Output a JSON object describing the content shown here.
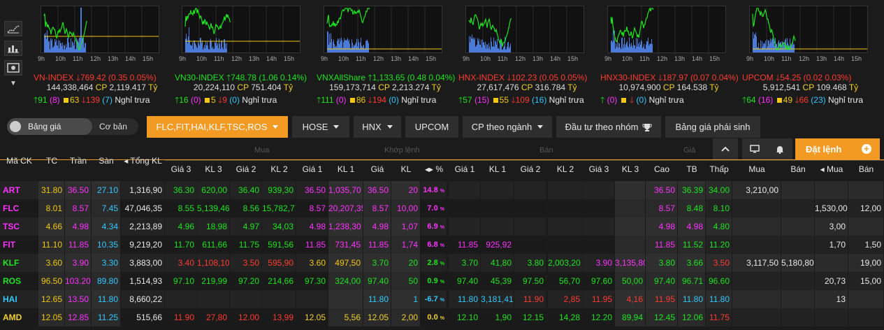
{
  "tool_icons": [
    "line-chart-icon",
    "bar-chart-icon",
    "display-settings-icon",
    "caret-down-icon"
  ],
  "hours": [
    "9h",
    "10h",
    "11h",
    "12h",
    "13h",
    "14h",
    "15h"
  ],
  "indexes": [
    {
      "name": "VN-INDEX",
      "dir": "dn",
      "value": "769.42",
      "change": "(0.35 0.05%)",
      "volume": "144,338,464",
      "cp_label": "CP",
      "cp_value": "2,119.417",
      "unit": "Tỷ",
      "up": "91",
      "ceil": "(8)",
      "ref": "63",
      "down": "139",
      "floor": "(7)",
      "session": "Nghỉ trưa"
    },
    {
      "name": "VN30-INDEX",
      "dir": "up",
      "value": "748.78",
      "change": "(1.06 0.14%)",
      "volume": "20,224,110",
      "cp_label": "CP",
      "cp_value": "751.404",
      "unit": "Tỷ",
      "up": "16",
      "ceil": "(0)",
      "ref": "5",
      "down": "9",
      "floor": "(0)",
      "session": "Nghỉ trưa"
    },
    {
      "name": "VNXAllShare",
      "dir": "up",
      "value": "1,133.65",
      "change": "(0.48 0.04%)",
      "volume": "159,173,714",
      "cp_label": "CP",
      "cp_value": "2,213.274",
      "unit": "Tỷ",
      "up": "111",
      "ceil": "(0)",
      "ref": "86",
      "down": "194",
      "floor": "(0)",
      "session": "Nghỉ trưa"
    },
    {
      "name": "HNX-INDEX",
      "dir": "dn",
      "value": "102.23",
      "change": "(0.05 0.05%)",
      "volume": "27,617,476",
      "cp_label": "CP",
      "cp_value": "316.784",
      "unit": "Tỷ",
      "up": "57",
      "ceil": "(15)",
      "ref": "55",
      "down": "109",
      "floor": "(16)",
      "session": "Nghỉ trưa"
    },
    {
      "name": "HNX30-INDEX",
      "dir": "dn",
      "value": "187.97",
      "change": "(0.07 0.04%)",
      "volume": "10,974,900",
      "cp_label": "CP",
      "cp_value": "164.538",
      "unit": "Tỷ",
      "up": "",
      "ceil": "(0)",
      "ref": "",
      "down": "",
      "floor": "(0)",
      "session": "Nghỉ trưa"
    },
    {
      "name": "UPCOM",
      "dir": "dn",
      "value": "54.25",
      "change": "(0.02 0.03%)",
      "volume": "5,912,541",
      "cp_label": "CP",
      "cp_value": "109.468",
      "unit": "Tỷ",
      "up": "64",
      "ceil": "(16)",
      "ref": "49",
      "down": "66",
      "floor": "(23)",
      "session": "Nghỉ trưa"
    }
  ],
  "toolbar": {
    "toggle_on": "Bảng giá",
    "toggle_off": "Cơ bản",
    "watchlist": "FLC,FIT,HAI,KLF,TSC,ROS",
    "hose": "HOSE",
    "hnx": "HNX",
    "upcom": "UPCOM",
    "sector": "CP theo ngành",
    "group": "Đầu tư theo nhóm",
    "derivatives": "Bảng giá phái sinh",
    "order": "Đặt lệnh"
  },
  "table": {
    "ghost_groups": [
      "Mua",
      "Khớp lệnh",
      "Bán",
      "Giá"
    ],
    "fixed_headers": [
      "Mã CK",
      "TC",
      "Trần",
      "Sàn",
      "Tổng KL"
    ],
    "sub_headers": [
      "Giá 3",
      "KL 3",
      "Giá 2",
      "KL 2",
      "Giá 1",
      "KL 1",
      "Giá",
      "KL",
      "%",
      "Giá 1",
      "KL 1",
      "Giá 2",
      "KL 2",
      "Giá 3",
      "KL 3",
      "Cao",
      "TB",
      "Thấp",
      "Mua",
      "Bán",
      "Mua",
      "Bán"
    ],
    "rows": [
      {
        "sym": "ART",
        "sc": "ce",
        "cells": [
          "31.80",
          "36.50",
          "27.10",
          "1,316,90",
          "36.30",
          "620,00",
          "36.40",
          "939,30",
          "36.50",
          "1,035,70",
          "36.50",
          "20",
          "14.8",
          "",
          "",
          "",
          "",
          "",
          "",
          "36.50",
          "36.39",
          "34.00",
          "3,210,00",
          "",
          "",
          ""
        ],
        "colors": [
          "ref",
          "ce",
          "fl",
          "wh",
          "up",
          "up",
          "up",
          "up",
          "ce",
          "ce",
          "ce",
          "ce",
          "ce",
          "",
          "",
          "",
          "",
          "",
          "",
          "ce",
          "up",
          "up",
          "wh",
          "",
          "",
          ""
        ]
      },
      {
        "sym": "FLC",
        "sc": "ce",
        "cells": [
          "8.01",
          "8.57",
          "7.45",
          "47,046,35",
          "8.55",
          "5,139,46",
          "8.56",
          "15,782,77",
          "8.57",
          "20,207,35",
          "8.57",
          "10,00",
          "7.0",
          "",
          "",
          "",
          "",
          "",
          "",
          "8.57",
          "8.48",
          "8.10",
          "",
          "",
          "1,530,00",
          "12,00"
        ],
        "colors": [
          "ref",
          "ce",
          "fl",
          "wh",
          "up",
          "up",
          "up",
          "up",
          "ce",
          "ce",
          "ce",
          "ce",
          "ce",
          "",
          "",
          "",
          "",
          "",
          "",
          "ce",
          "up",
          "up",
          "",
          "",
          "wh",
          "wh"
        ]
      },
      {
        "sym": "TSC",
        "sc": "ce",
        "cells": [
          "4.66",
          "4.98",
          "4.34",
          "2,213,89",
          "4.96",
          "18,98",
          "4.97",
          "34,03",
          "4.98",
          "1,238,30",
          "4.98",
          "1,07",
          "6.9",
          "",
          "",
          "",
          "",
          "",
          "",
          "4.98",
          "4.98",
          "4.80",
          "",
          "",
          "3,00",
          ""
        ],
        "colors": [
          "ref",
          "ce",
          "fl",
          "wh",
          "up",
          "up",
          "up",
          "up",
          "ce",
          "ce",
          "ce",
          "ce",
          "ce",
          "",
          "",
          "",
          "",
          "",
          "",
          "ce",
          "ce",
          "up",
          "",
          "",
          "wh",
          ""
        ]
      },
      {
        "sym": "FIT",
        "sc": "ce",
        "cells": [
          "11.10",
          "11.85",
          "10.35",
          "9,219,20",
          "11.70",
          "611,66",
          "11.75",
          "591,56",
          "11.85",
          "731,45",
          "11.85",
          "1,74",
          "6.8",
          "11.85",
          "925,92",
          "",
          "",
          "",
          "",
          "11.85",
          "11.52",
          "11.20",
          "",
          "",
          "1,70",
          "1,50"
        ],
        "colors": [
          "ref",
          "ce",
          "fl",
          "wh",
          "up",
          "up",
          "up",
          "up",
          "ce",
          "ce",
          "ce",
          "ce",
          "ce",
          "ce",
          "ce",
          "",
          "",
          "",
          "",
          "ce",
          "up",
          "up",
          "",
          "",
          "wh",
          "wh"
        ]
      },
      {
        "sym": "KLF",
        "sc": "up",
        "cells": [
          "3.60",
          "3.90",
          "3.30",
          "3,883,00",
          "3.40",
          "1,108,10",
          "3.50",
          "595,90",
          "3.60",
          "497,50",
          "3.70",
          "20",
          "2.8",
          "3.70",
          "41,80",
          "3.80",
          "2,003,20",
          "3.90",
          "3,135,80",
          "3.80",
          "3.66",
          "3.50",
          "3,117,50",
          "5,180,80",
          "",
          "19,00"
        ],
        "colors": [
          "ref",
          "ce",
          "fl",
          "wh",
          "dn",
          "dn",
          "dn",
          "dn",
          "ref",
          "ref",
          "up",
          "up",
          "up",
          "up",
          "up",
          "up",
          "up",
          "ce",
          "ce",
          "up",
          "up",
          "dn",
          "wh",
          "wh",
          "",
          "wh"
        ]
      },
      {
        "sym": "ROS",
        "sc": "up",
        "cells": [
          "96.50",
          "103.20",
          "89.80",
          "1,514,93",
          "97.10",
          "219,99",
          "97.20",
          "214,66",
          "97.30",
          "324,00",
          "97.40",
          "50",
          "0.9",
          "97.40",
          "45,39",
          "97.50",
          "56,70",
          "97.60",
          "50,00",
          "97.40",
          "96.71",
          "96.60",
          "",
          "",
          "20,73",
          "15,00"
        ],
        "colors": [
          "ref",
          "ce",
          "fl",
          "wh",
          "up",
          "up",
          "up",
          "up",
          "up",
          "up",
          "up",
          "up",
          "up",
          "up",
          "up",
          "up",
          "up",
          "up",
          "up",
          "up",
          "up",
          "up",
          "",
          "",
          "wh",
          "wh"
        ]
      },
      {
        "sym": "HAI",
        "sc": "fl",
        "cells": [
          "12.65",
          "13.50",
          "11.80",
          "8,660,22",
          "",
          "",
          "",
          "",
          "",
          "",
          "11.80",
          "1",
          "-6.7",
          "11.80",
          "3,181,41",
          "11.90",
          "2,85",
          "11.95",
          "4,16",
          "11.95",
          "11.80",
          "11.80",
          "",
          "",
          "13",
          ""
        ],
        "colors": [
          "ref",
          "ce",
          "fl",
          "wh",
          "",
          "",
          "",
          "",
          "",
          "",
          "fl",
          "fl",
          "fl",
          "fl",
          "fl",
          "dn",
          "dn",
          "dn",
          "dn",
          "dn",
          "fl",
          "fl",
          "",
          "",
          "wh",
          ""
        ]
      },
      {
        "sym": "AMD",
        "sc": "yl",
        "cells": [
          "12.05",
          "12.85",
          "11.25",
          "515,66",
          "11.90",
          "27,80",
          "12.00",
          "13,99",
          "12.05",
          "5,56",
          "12.05",
          "2,00",
          "0.0",
          "12.10",
          "1,90",
          "12.15",
          "14,28",
          "12.20",
          "89,94",
          "12.45",
          "12.06",
          "11.75",
          "",
          "",
          "",
          ""
        ],
        "colors": [
          "ref",
          "ce",
          "fl",
          "wh",
          "dn",
          "dn",
          "dn",
          "dn",
          "yl",
          "yl",
          "yl",
          "yl",
          "yl",
          "up",
          "up",
          "up",
          "up",
          "up",
          "up",
          "up",
          "up",
          "dn",
          "",
          "",
          "",
          ""
        ]
      }
    ]
  }
}
